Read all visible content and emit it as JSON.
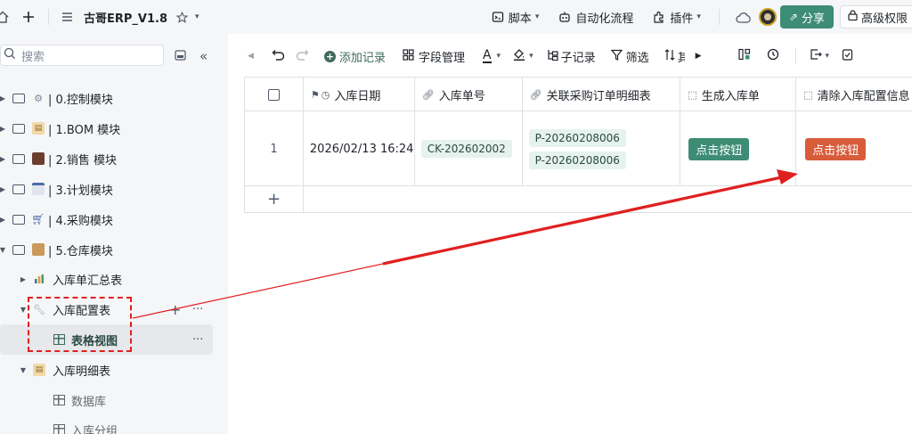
{
  "topbar": {
    "title": "古哥ERP_V1.8",
    "menus": [
      {
        "label": "脚本",
        "has_chevron": true
      },
      {
        "label": "自动化流程",
        "has_chevron": false
      },
      {
        "label": "插件",
        "has_chevron": true
      }
    ],
    "share_label": "分享",
    "advanced_label": "高级权限"
  },
  "sidebar": {
    "search_placeholder": "搜索",
    "items": [
      {
        "label": "| 0.控制模块",
        "icon": "gear-icon"
      },
      {
        "label": "| 1.BOM 模块",
        "icon": "clipboard-icon"
      },
      {
        "label": "| 2.销售 模块",
        "icon": "briefcase-icon"
      },
      {
        "label": "| 3.计划模块",
        "icon": "calendar-icon"
      },
      {
        "label": "| 4.采购模块",
        "icon": "cart-icon"
      },
      {
        "label": "| 5.仓库模块",
        "icon": "box-icon"
      },
      {
        "label": "入库单汇总表",
        "icon": "bar-chart-icon"
      },
      {
        "label": "入库配置表",
        "icon": "wrench-icon"
      },
      {
        "label": "表格视图",
        "icon": "grid-view-icon"
      },
      {
        "label": "入库明细表",
        "icon": "clipboard-icon"
      },
      {
        "label": "数据库",
        "icon": "grid-view-icon"
      },
      {
        "label": "入库分组",
        "icon": "grid-view-icon"
      }
    ]
  },
  "toolbar": {
    "add_record": "添加记录",
    "field_manage": "字段管理",
    "sub_record": "子记录",
    "filter": "筛选",
    "more_label": "其"
  },
  "table": {
    "columns": [
      "入库日期",
      "入库单号",
      "关联采购订单明细表",
      "生成入库单",
      "清除入库配置信息"
    ],
    "rows": [
      {
        "index": "1",
        "date": "2026/02/13 16:24",
        "doc_no": "CK-202602002",
        "linked": [
          "P-20260208006",
          "P-20260208006"
        ],
        "generate_btn": "点击按钮",
        "clear_btn": "点击按钮"
      }
    ],
    "add_row_symbol": "+"
  },
  "colors": {
    "accent_green": "#3d8c74",
    "button_orange": "#d85c3a",
    "annotation_red": "#e02020"
  }
}
